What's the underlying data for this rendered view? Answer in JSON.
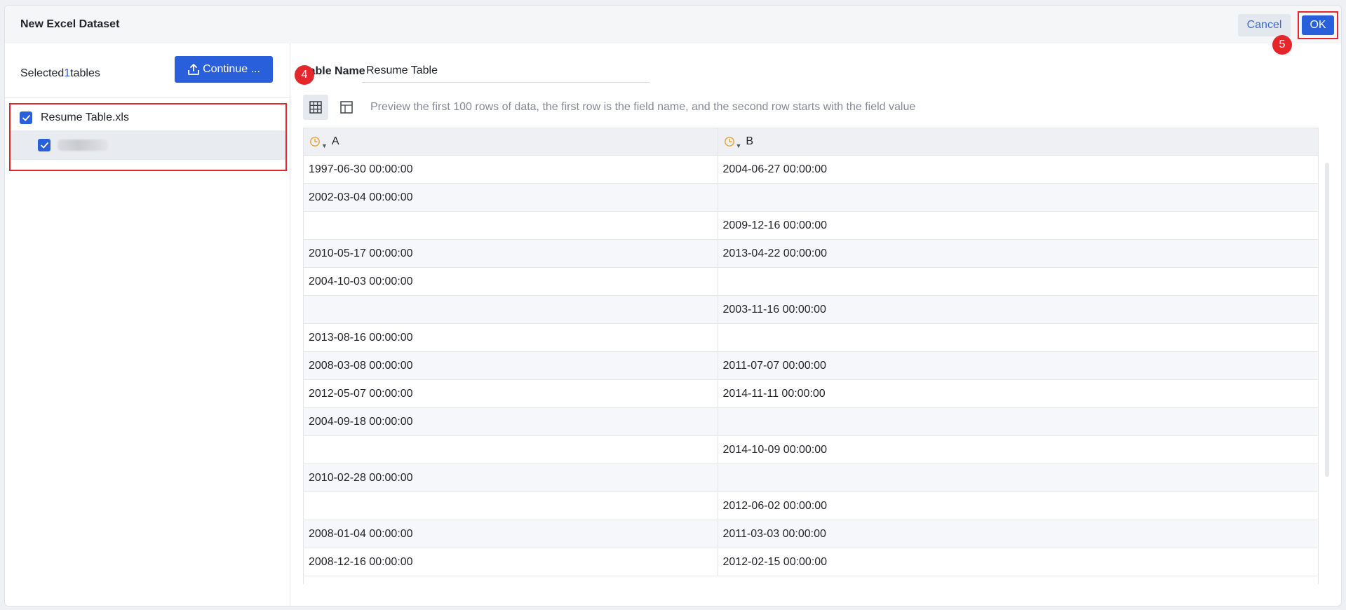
{
  "dialog": {
    "title": "New Excel Dataset",
    "cancel_label": "Cancel",
    "ok_label": "OK"
  },
  "steps": {
    "step4": "4",
    "step5": "5"
  },
  "left": {
    "selected_prefix": "Selected",
    "selected_count": "1",
    "selected_suffix": "tables",
    "continue_label": "Continue ...",
    "file_name": "Resume Table.xls"
  },
  "right": {
    "table_name_label": "Table Name",
    "table_name_value": "Resume Table",
    "preview_hint": "Preview the first 100 rows of data, the first row is the field name, and the second row starts with the field value"
  },
  "table": {
    "columns": [
      {
        "name": "A",
        "type_icon": "clock-icon"
      },
      {
        "name": "B",
        "type_icon": "clock-icon"
      }
    ],
    "rows": [
      [
        "1997-06-30 00:00:00",
        "2004-06-27 00:00:00"
      ],
      [
        "2002-03-04 00:00:00",
        ""
      ],
      [
        "",
        "2009-12-16 00:00:00"
      ],
      [
        "2010-05-17 00:00:00",
        "2013-04-22 00:00:00"
      ],
      [
        "2004-10-03 00:00:00",
        ""
      ],
      [
        "",
        "2003-11-16 00:00:00"
      ],
      [
        "2013-08-16 00:00:00",
        ""
      ],
      [
        "2008-03-08 00:00:00",
        "2011-07-07 00:00:00"
      ],
      [
        "2012-05-07 00:00:00",
        "2014-11-11 00:00:00"
      ],
      [
        "2004-09-18 00:00:00",
        ""
      ],
      [
        "",
        "2014-10-09 00:00:00"
      ],
      [
        "2010-02-28 00:00:00",
        ""
      ],
      [
        "",
        "2012-06-02 00:00:00"
      ],
      [
        "2008-01-04 00:00:00",
        "2011-03-03 00:00:00"
      ],
      [
        "2008-12-16 00:00:00",
        "2012-02-15 00:00:00"
      ]
    ]
  },
  "colors": {
    "primary": "#2a5fdc",
    "highlight": "#e5262b",
    "type_icon": "#e8a32e"
  }
}
